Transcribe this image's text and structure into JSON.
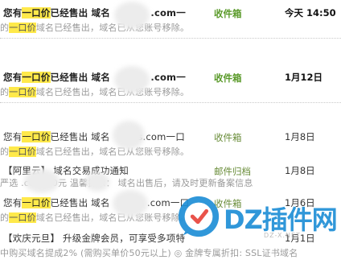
{
  "emails": [
    {
      "subject_parts": [
        "您有",
        "一口价",
        "已经售出 域名",
        ".com一"
      ],
      "folder": "收件箱",
      "date": "今天 14:50",
      "preview_parts": [
        "的",
        "一口价",
        "域名已经售出，域名已从您账号移除。"
      ]
    },
    {
      "subject_parts": [
        "您有",
        "一口价",
        "已经售出 域名",
        ".com一"
      ],
      "folder": "收件箱",
      "date": "1月12日",
      "preview_parts": [
        "的",
        "一口价",
        "域名已经售出，域名已从您账号移除。"
      ]
    },
    {
      "subject_parts": [
        "您有",
        "一口价",
        "已经售出 域名",
        "s.com一口"
      ],
      "folder": "收件箱",
      "date": "1月8日",
      "preview_parts": [
        "的",
        "一口价",
        "域名已经售出，域名已从您账号移除。"
      ]
    },
    {
      "subject": "【阿里云】 域名交易成功通知",
      "folder": "邮件归档",
      "date": "1月8日",
      "preview": "严选          .com        00元 温馨提示： 域名出售后，请及时更新备案信息"
    },
    {
      "subject_parts": [
        "您有",
        "一口价",
        "已经售出 域名",
        ".com一口"
      ],
      "folder": "收件箱",
      "date": "1月6日",
      "preview_parts": [
        "的",
        "一口价",
        "域名已经售出，域名已从您账号移除。"
      ]
    },
    {
      "subject": "【欢庆元旦】 升级金牌会员，可享受多项特",
      "folder": "",
      "date": "1月1日",
      "preview": "中购买域名提成2% (需购买单价50元以上) ◎ 金牌专属折扣: SSL证书域名"
    }
  ],
  "watermark": {
    "text": "DZ插件网",
    "url": "DZ-X.NET",
    "color": "#1f8fd6"
  }
}
